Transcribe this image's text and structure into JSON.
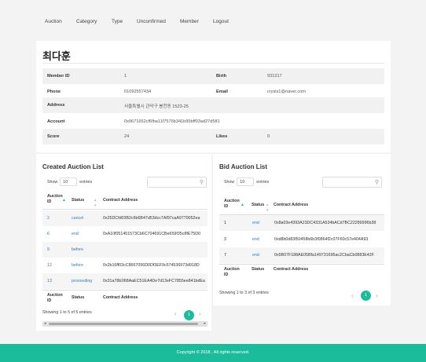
{
  "nav": {
    "items": [
      "Auction",
      "Category",
      "Type",
      "Unconfirmed",
      "Member",
      "Logout"
    ]
  },
  "profile": {
    "name": "최다훈",
    "member_id_label": "Member ID",
    "member_id": "1",
    "birth_label": "Birth",
    "birth": "931217",
    "phone_label": "Phone",
    "phone": "01092557434",
    "email_label": "Email",
    "email": "crysis1@naver.com",
    "address_label": "Address",
    "address": "서울특별시 관악구 봉천동 1523-25",
    "account_label": "Account",
    "account": "0x9671652cf6fba11f7576b341b95bff03ad27d581",
    "score_label": "Score",
    "score": "24",
    "likes_label": "Likes",
    "likes": "0"
  },
  "created": {
    "title": "Created Auction List",
    "show_label": "Show",
    "length": "10",
    "entries_label": "entries",
    "columns": [
      "Auction ID",
      "Status",
      "Contract Address"
    ],
    "rows": [
      {
        "id": "2",
        "status": "cancel",
        "address": "0x25DCfd03B2c6b6B47d53dcc7Af97caA9770052ea"
      },
      {
        "id": "6",
        "status": "end",
        "address": "0xA10f051451573Cb6C704691CBe659f35c8fE75D0"
      },
      {
        "id": "9",
        "status": "before",
        "address": ""
      },
      {
        "id": "12",
        "status": "before",
        "address": "0x2b16ff03cC8667056D0Df3EF9c574536973d918D"
      },
      {
        "id": "13",
        "status": "proceeding",
        "address": "0x31a78E068AaEC51EA4De7d13eFC7855ee841bdEa"
      }
    ],
    "info": "Showing 1 to 5 of 5 entries",
    "page": "1",
    "prev": "‹",
    "next": "›"
  },
  "bid": {
    "title": "Bid Auction List",
    "show_label": "Show",
    "length": "10",
    "entries_label": "entries",
    "columns": [
      "Auction ID",
      "Status",
      "Contract Address"
    ],
    "rows": [
      {
        "id": "1",
        "status": "end",
        "address": "0x8a03e4393A23DC4331A534bACd7BC22289996b38"
      },
      {
        "id": "3",
        "status": "end",
        "address": "0xd8b0d83f50458b6b3f0864f2c07F60c57e404A93"
      },
      {
        "id": "7",
        "status": "end",
        "address": "0x5B07F188AE05Bfa149731695ac2CbaCb0883E42F"
      }
    ],
    "info": "Showing 1 to 3 of 3 entries",
    "page": "1",
    "prev": "‹",
    "next": "›"
  },
  "footer": {
    "text": "Copyright © 2018 . All rights reserved."
  },
  "colors": {
    "accent": "#1bbc9b",
    "link": "#337ab7"
  }
}
